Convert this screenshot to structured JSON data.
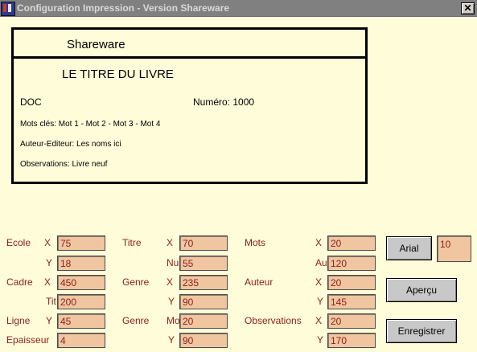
{
  "window": {
    "title": "Configuration Impression - Version Shareware",
    "close_glyph": "✕"
  },
  "preview": {
    "header": "Shareware",
    "book_title": "LE TITRE DU LIVRE",
    "doc": "DOC",
    "numero": "Numéro: 1000",
    "keywords": "Mots clés: Mot 1 - Mot 2 - Mot 3 - Mot 4",
    "author": "Auteur-Editeur: Les noms ici",
    "observations": "Observations: Livre neuf"
  },
  "labels": {
    "ecole": "Ecole",
    "cadre": "Cadre",
    "ligne": "Ligne",
    "epaisseur": "Epaisseur",
    "titre": "Titre",
    "genre": "Genre",
    "genre2": "Genre",
    "mots": "Mots",
    "auteur": "Auteur",
    "observations": "Observations",
    "x": "X",
    "y": "Y",
    "nu": "Nu",
    "au": "Au",
    "tit": "Tit",
    "mo": "Mo"
  },
  "fields": {
    "ecole_x": "75",
    "ecole_y": "18",
    "cadre_x": "450",
    "cadre_tit": "200",
    "ligne_y": "45",
    "epaisseur": "4",
    "titre_x": "70",
    "titre_nu": "55",
    "genre_x": "235",
    "genre_y": "90",
    "genre2_mo": "20",
    "genre2_y": "90",
    "mots_x": "20",
    "mots_au": "120",
    "auteur_x": "20",
    "auteur_y": "145",
    "obs_x": "20",
    "obs_y": "170",
    "font_size": "10"
  },
  "buttons": {
    "font": "Arial",
    "preview": "Aperçu",
    "save": "Enregistrer"
  }
}
